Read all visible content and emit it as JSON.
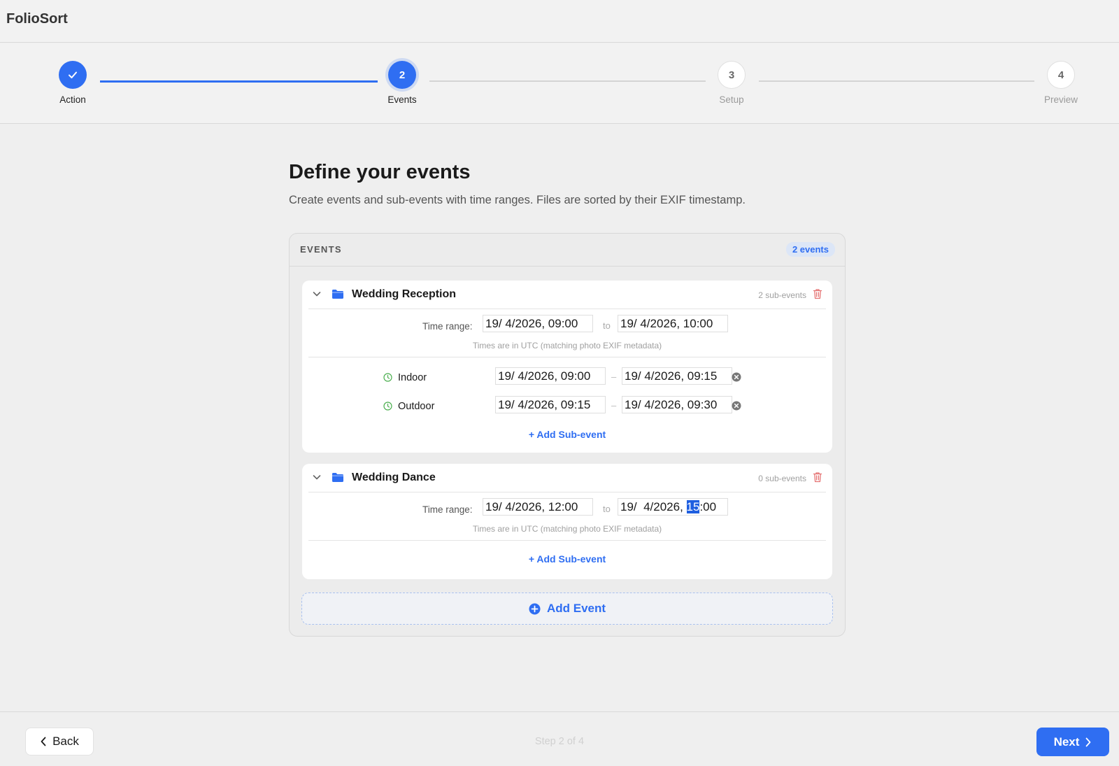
{
  "app": {
    "title": "FolioSort"
  },
  "stepper": {
    "steps": [
      {
        "number": "1",
        "label": "Action",
        "state": "done"
      },
      {
        "number": "2",
        "label": "Events",
        "state": "current"
      },
      {
        "number": "3",
        "label": "Setup",
        "state": "todo"
      },
      {
        "number": "4",
        "label": "Preview",
        "state": "todo"
      }
    ]
  },
  "page": {
    "title": "Define your events",
    "description": "Create events and sub-events with time ranges. Files are sorted by their EXIF timestamp."
  },
  "events_panel": {
    "title": "EVENTS",
    "count_label": "2 events",
    "events": [
      {
        "name": "Wedding Reception",
        "sub_count_label": "2 sub-events",
        "time_range_label": "Time range:",
        "start": "19/  4/2026, 09:00",
        "to_label": "to",
        "end": "19/  4/2026, 10:00",
        "utc_note": "Times are in UTC (matching photo EXIF metadata)",
        "sub_events": [
          {
            "name": "Indoor",
            "start": "19/  4/2026, 09:00",
            "separator": "–",
            "end": "19/  4/2026, 09:15"
          },
          {
            "name": "Outdoor",
            "start": "19/  4/2026, 09:15",
            "separator": "–",
            "end": "19/  4/2026, 09:30"
          }
        ],
        "add_sub_label": "Add Sub-event"
      },
      {
        "name": "Wedding Dance",
        "sub_count_label": "0 sub-events",
        "time_range_label": "Time range:",
        "start": "19/  4/2026, 12:00",
        "to_label": "to",
        "end_prefix": "19/  4/2026, ",
        "end_selected": "15",
        "end_suffix": ":00",
        "utc_note": "Times are in UTC (matching photo EXIF metadata)",
        "add_sub_label": "Add Sub-event"
      }
    ],
    "add_event_label": "Add Event"
  },
  "footer": {
    "back_label": "Back",
    "step_indicator": "Step 2 of 4",
    "next_label": "Next"
  },
  "colors": {
    "accent": "#2f6ef2",
    "success": "#4caf50",
    "danger": "#e57373"
  },
  "icons": {
    "check": "check-icon",
    "chevron_down": "chevron-down-icon",
    "folder": "folder-icon",
    "trash": "trash-icon",
    "clock": "clock-icon",
    "remove": "remove-icon",
    "plus": "plus-icon",
    "plus_circle": "plus-circle-icon",
    "chevron_left": "chevron-left-icon",
    "chevron_right": "chevron-right-icon"
  }
}
